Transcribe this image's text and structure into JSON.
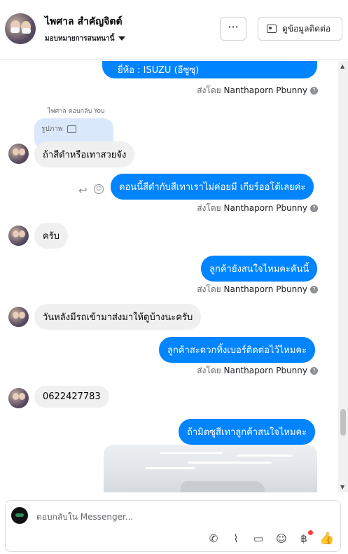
{
  "header": {
    "name": "ไพศาล สำคัญจิตต์",
    "subtitle": "มอบหมายการสนทนานี้",
    "more_label": "···",
    "contact_button": "ดูข้อมูลติดต่อ"
  },
  "thread": {
    "brand_line": "ยี่ห้อ : ISUZU (อีซูซุ)",
    "sent_by_prefix": "ส่งโดย",
    "sender": "Nanthaporn Pbunny",
    "reply_note": "ไพศาล ตอบกลับ You",
    "reply_quote": "รูปภาพ",
    "msg_in_1": "ถ้าสีดำหรือเทาสวยจัง",
    "msg_out_1": "ตอนนี้สีดำกับสีเทาเราไม่ค่อยมี เกียร์ออโต้เลยค่ะ",
    "msg_in_2": "ครับ",
    "msg_out_2": "ลูกค้ายังสนใจไหมคะคันนี้",
    "msg_in_3": "วันหลังมีรถเข้ามาส่งมาให้ดูบ้างนะครับ",
    "msg_out_3": "ลูกค้าสะดวกทิ้งเบอร์ติดต่อไว้ไหมคะ",
    "msg_in_4": "0622427783",
    "msg_out_4": "ถ้ามิตซูสีเทาลูกค้าสนใจไหมคะ"
  },
  "composer": {
    "placeholder": "ตอบกลับใน Messenger..."
  },
  "icons": [
    "avatar",
    "more-icon",
    "contact-card-icon",
    "image-icon",
    "reply-icon",
    "emoji-icon",
    "call-icon",
    "attach-icon",
    "saved-reply-icon",
    "emoji-icon",
    "baht-icon",
    "like-icon"
  ],
  "colors": {
    "outgoing": "#0084ff",
    "incoming": "#f0f0f0",
    "notification": "#fa3e3e"
  }
}
